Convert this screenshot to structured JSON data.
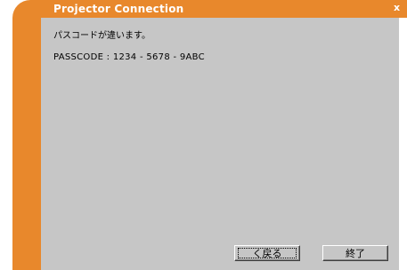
{
  "window": {
    "title": "Projector Connection",
    "close_glyph": "x",
    "accent_color": "#e8882c",
    "content_bg": "#c6c6c6"
  },
  "message": {
    "line1": "パスコードが違います。",
    "line2": "PASSCODE : 1234 - 5678 - 9ABC"
  },
  "buttons": {
    "back_label": "く戻る",
    "exit_label": "終了"
  }
}
